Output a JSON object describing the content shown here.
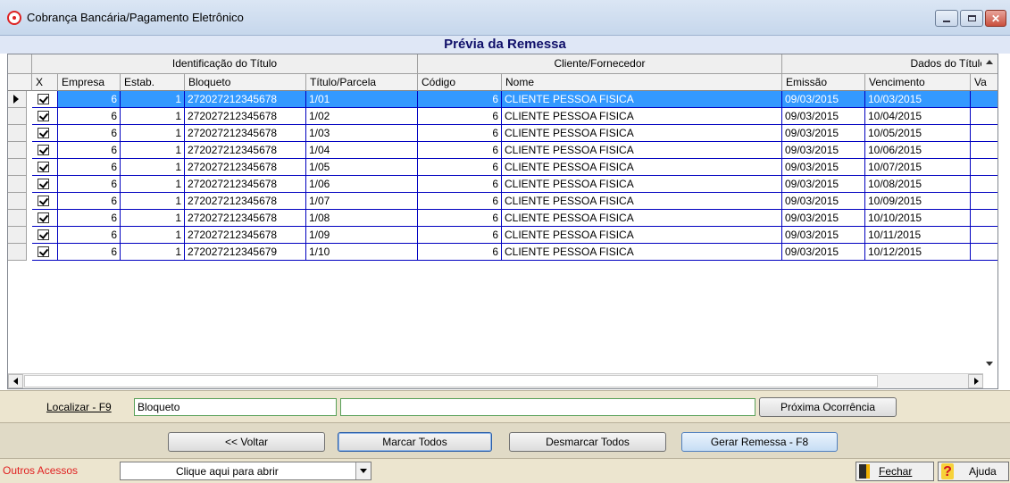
{
  "window": {
    "title": "Cobrança Bancária/Pagamento Eletrônico",
    "subtitle": "Prévia da Remessa"
  },
  "grid": {
    "groups": [
      "Identificação do Título",
      "Cliente/Fornecedor",
      "Dados do Título"
    ],
    "columns": [
      "X",
      "Empresa",
      "Estab.",
      "Bloqueto",
      "Título/Parcela",
      "Código",
      "Nome",
      "Emissão",
      "Vencimento",
      "Va"
    ],
    "rows": [
      {
        "empresa": "6",
        "estab": "1",
        "bloqueto": "272027212345678",
        "titulo": "1/01",
        "codigo": "6",
        "nome": "CLIENTE PESSOA FISICA",
        "emissao": "09/03/2015",
        "vencimento": "10/03/2015"
      },
      {
        "empresa": "6",
        "estab": "1",
        "bloqueto": "272027212345678",
        "titulo": "1/02",
        "codigo": "6",
        "nome": "CLIENTE PESSOA FISICA",
        "emissao": "09/03/2015",
        "vencimento": "10/04/2015"
      },
      {
        "empresa": "6",
        "estab": "1",
        "bloqueto": "272027212345678",
        "titulo": "1/03",
        "codigo": "6",
        "nome": "CLIENTE PESSOA FISICA",
        "emissao": "09/03/2015",
        "vencimento": "10/05/2015"
      },
      {
        "empresa": "6",
        "estab": "1",
        "bloqueto": "272027212345678",
        "titulo": "1/04",
        "codigo": "6",
        "nome": "CLIENTE PESSOA FISICA",
        "emissao": "09/03/2015",
        "vencimento": "10/06/2015"
      },
      {
        "empresa": "6",
        "estab": "1",
        "bloqueto": "272027212345678",
        "titulo": "1/05",
        "codigo": "6",
        "nome": "CLIENTE PESSOA FISICA",
        "emissao": "09/03/2015",
        "vencimento": "10/07/2015"
      },
      {
        "empresa": "6",
        "estab": "1",
        "bloqueto": "272027212345678",
        "titulo": "1/06",
        "codigo": "6",
        "nome": "CLIENTE PESSOA FISICA",
        "emissao": "09/03/2015",
        "vencimento": "10/08/2015"
      },
      {
        "empresa": "6",
        "estab": "1",
        "bloqueto": "272027212345678",
        "titulo": "1/07",
        "codigo": "6",
        "nome": "CLIENTE PESSOA FISICA",
        "emissao": "09/03/2015",
        "vencimento": "10/09/2015"
      },
      {
        "empresa": "6",
        "estab": "1",
        "bloqueto": "272027212345678",
        "titulo": "1/08",
        "codigo": "6",
        "nome": "CLIENTE PESSOA FISICA",
        "emissao": "09/03/2015",
        "vencimento": "10/10/2015"
      },
      {
        "empresa": "6",
        "estab": "1",
        "bloqueto": "272027212345678",
        "titulo": "1/09",
        "codigo": "6",
        "nome": "CLIENTE PESSOA FISICA",
        "emissao": "09/03/2015",
        "vencimento": "10/11/2015"
      },
      {
        "empresa": "6",
        "estab": "1",
        "bloqueto": "272027212345679",
        "titulo": "1/10",
        "codigo": "6",
        "nome": "CLIENTE PESSOA FISICA",
        "emissao": "09/03/2015",
        "vencimento": "10/12/2015"
      }
    ]
  },
  "search": {
    "label": "Localizar - F9",
    "field_value": "Bloqueto",
    "text_value": "",
    "next_button": "Próxima Ocorrência"
  },
  "actions": {
    "back": "<< Voltar",
    "mark_all": "Marcar Todos",
    "unmark_all": "Desmarcar Todos",
    "generate": "Gerar Remessa - F8"
  },
  "footer": {
    "other_access_label": "Outros Acessos",
    "combo_value": "Clique aqui para abrir",
    "close": "Fechar",
    "help": "Ajuda"
  },
  "colors": {
    "selection": "#3399ff",
    "grid_lines": "#0000c0",
    "subtitle_text": "#10106a",
    "panel": "#ece5cf"
  }
}
